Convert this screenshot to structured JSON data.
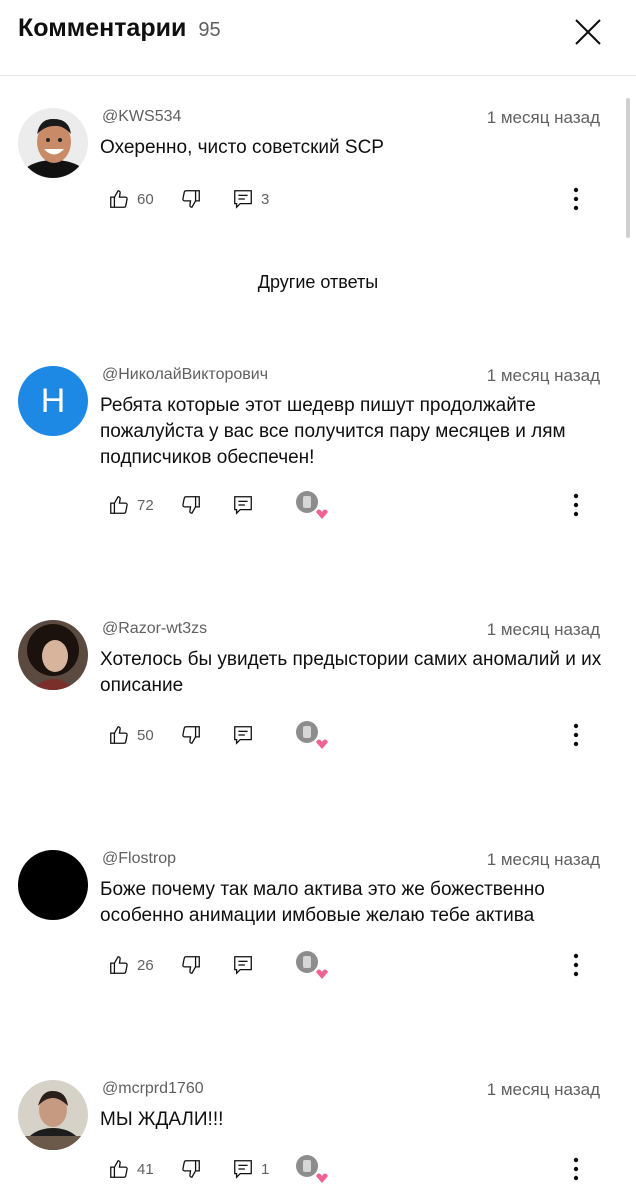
{
  "header": {
    "title": "Комментарии",
    "count": "95"
  },
  "other_replies_label": "Другие ответы",
  "comments": [
    {
      "author": "@KWS534",
      "time": "1 месяц назад",
      "text": "Охеренно, чисто советский SCP",
      "likes": "60",
      "replies": "3",
      "avatar_type": "photo-man-smiling"
    },
    {
      "author": "@НиколайВикторович",
      "time": "1 месяц назад",
      "text": "Ребята которые этот шедевр пишут продолжайте пожалуйста у вас все получится пару месяцев и лям подписчиков обеспечен!",
      "likes": "72",
      "replies": "",
      "avatar_letter": "Н",
      "avatar_color": "#1e88e5"
    },
    {
      "author": "@Razor-wt3zs",
      "time": "1 месяц назад",
      "text": "Хотелось бы увидеть предыстории самих аномалий и их описание",
      "likes": "50",
      "replies": "",
      "avatar_type": "photo-dark-hair"
    },
    {
      "author": "@Flostrop",
      "time": "1 месяц назад",
      "text": "Боже почему так мало актива это же божественно особенно анимации имбовые желаю тебе актива",
      "likes": "26",
      "replies": "",
      "avatar_color": "#000000"
    },
    {
      "author": "@mcrprd1760",
      "time": "1 месяц назад",
      "text": "МЫ ЖДАЛИ!!!",
      "likes": "41",
      "replies": "1",
      "avatar_type": "photo-person-desk"
    }
  ],
  "colors": {
    "text": "#0f0f0f",
    "secondary": "#606060",
    "heart": "#f06292"
  }
}
